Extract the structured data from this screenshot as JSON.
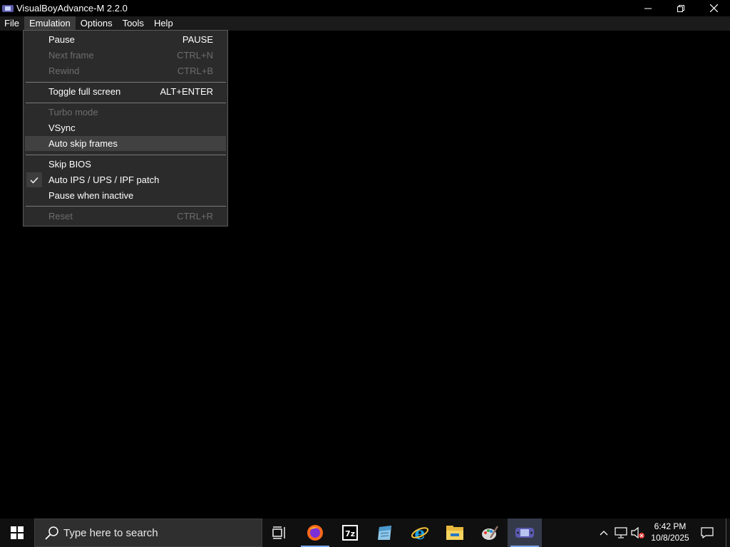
{
  "window": {
    "title": "VisualBoyAdvance-M 2.2.0"
  },
  "menubar": {
    "items": [
      "File",
      "Emulation",
      "Options",
      "Tools",
      "Help"
    ],
    "open_item": "Emulation"
  },
  "emulation_menu": {
    "items": [
      {
        "label": "Pause",
        "shortcut": "PAUSE",
        "enabled": true
      },
      {
        "label": "Next frame",
        "shortcut": "CTRL+N",
        "enabled": false
      },
      {
        "label": "Rewind",
        "shortcut": "CTRL+B",
        "enabled": false
      },
      {
        "label": "Toggle full screen",
        "shortcut": "ALT+ENTER",
        "enabled": true
      },
      {
        "label": "Turbo mode",
        "shortcut": "",
        "enabled": false
      },
      {
        "label": "VSync",
        "shortcut": "",
        "enabled": true
      },
      {
        "label": "Auto skip frames",
        "shortcut": "",
        "enabled": true,
        "highlighted": true
      },
      {
        "label": "Skip BIOS",
        "shortcut": "",
        "enabled": true
      },
      {
        "label": "Auto IPS / UPS / IPF patch",
        "shortcut": "",
        "enabled": true,
        "checked": true
      },
      {
        "label": "Pause when inactive",
        "shortcut": "",
        "enabled": true
      },
      {
        "label": "Reset",
        "shortcut": "CTRL+R",
        "enabled": false
      }
    ]
  },
  "taskbar": {
    "search_placeholder": "Type here to search",
    "pinned_icons": [
      "task-view-icon",
      "firefox-icon",
      "7zip-icon",
      "notepad-icon",
      "internet-explorer-icon",
      "file-explorer-icon",
      "paint-icon",
      "visualboyadvance-icon"
    ],
    "active_app": "visualboyadvance-icon",
    "clock_time": "6:42 PM",
    "clock_date": "10/8/2025"
  },
  "colors": {
    "menu_bg": "#2b2b2b",
    "menubar_bg": "#1b1b1b",
    "disabled_text": "#6d6d6d",
    "highlight": "#414141"
  }
}
